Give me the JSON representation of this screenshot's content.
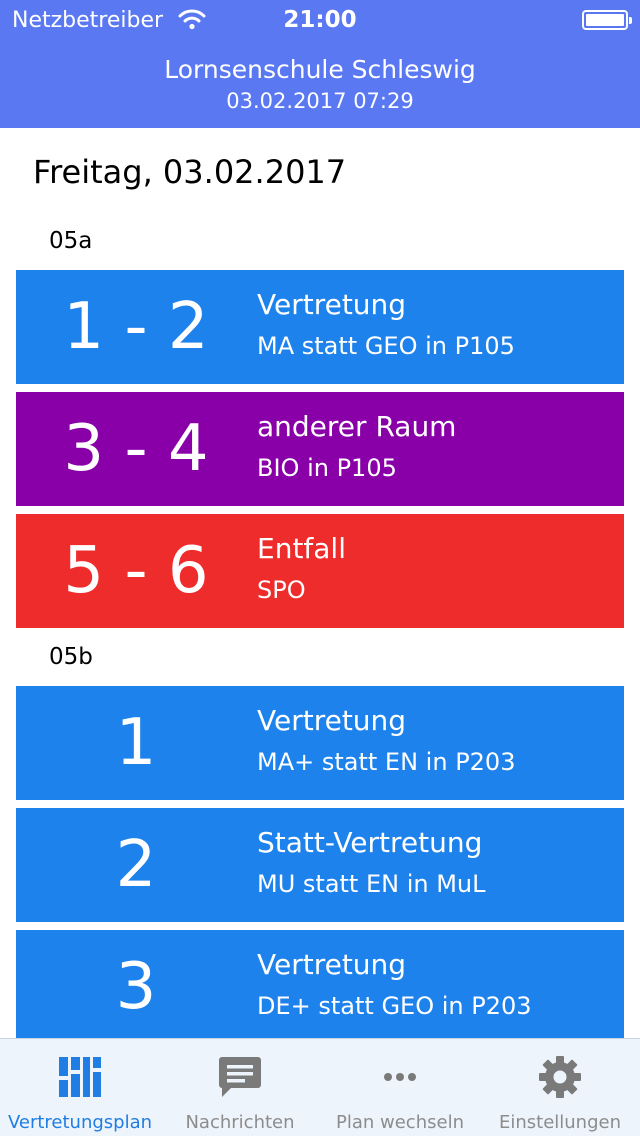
{
  "status_bar": {
    "carrier": "Netzbetreiber",
    "time": "21:00"
  },
  "header": {
    "title": "Lornsenschule Schleswig",
    "subtitle": "03.02.2017 07:29"
  },
  "day": "Freitag, 03.02.2017",
  "classes": [
    {
      "label": "05a",
      "entries": [
        {
          "period": "1 - 2",
          "type": "Vertretung",
          "detail": "MA statt GEO in P105",
          "color": "#1e82ec"
        },
        {
          "period": "3 - 4",
          "type": "anderer Raum",
          "detail": "BIO in P105",
          "color": "#8a00a8"
        },
        {
          "period": "5 - 6",
          "type": "Entfall",
          "detail": "SPO",
          "color": "#ee2c2c"
        }
      ]
    },
    {
      "label": "05b",
      "entries": [
        {
          "period": "1",
          "type": "Vertretung",
          "detail": "MA+ statt EN in P203",
          "color": "#1e82ec"
        },
        {
          "period": "2",
          "type": "Statt-Vertretung",
          "detail": "MU statt EN in MuL",
          "color": "#1e82ec"
        },
        {
          "period": "3",
          "type": "Vertretung",
          "detail": "DE+ statt GEO in P203",
          "color": "#1e82ec"
        }
      ]
    }
  ],
  "tabs": [
    {
      "label": "Vertretungsplan",
      "icon": "dashboard-icon",
      "active": true
    },
    {
      "label": "Nachrichten",
      "icon": "message-icon",
      "active": false
    },
    {
      "label": "Plan wechseln",
      "icon": "more-icon",
      "active": false
    },
    {
      "label": "Einstellungen",
      "icon": "gear-icon",
      "active": false
    }
  ],
  "colors": {
    "header": "#5a78f2",
    "active_tab": "#1f7de3",
    "inactive_tab": "#8c8c8c"
  }
}
